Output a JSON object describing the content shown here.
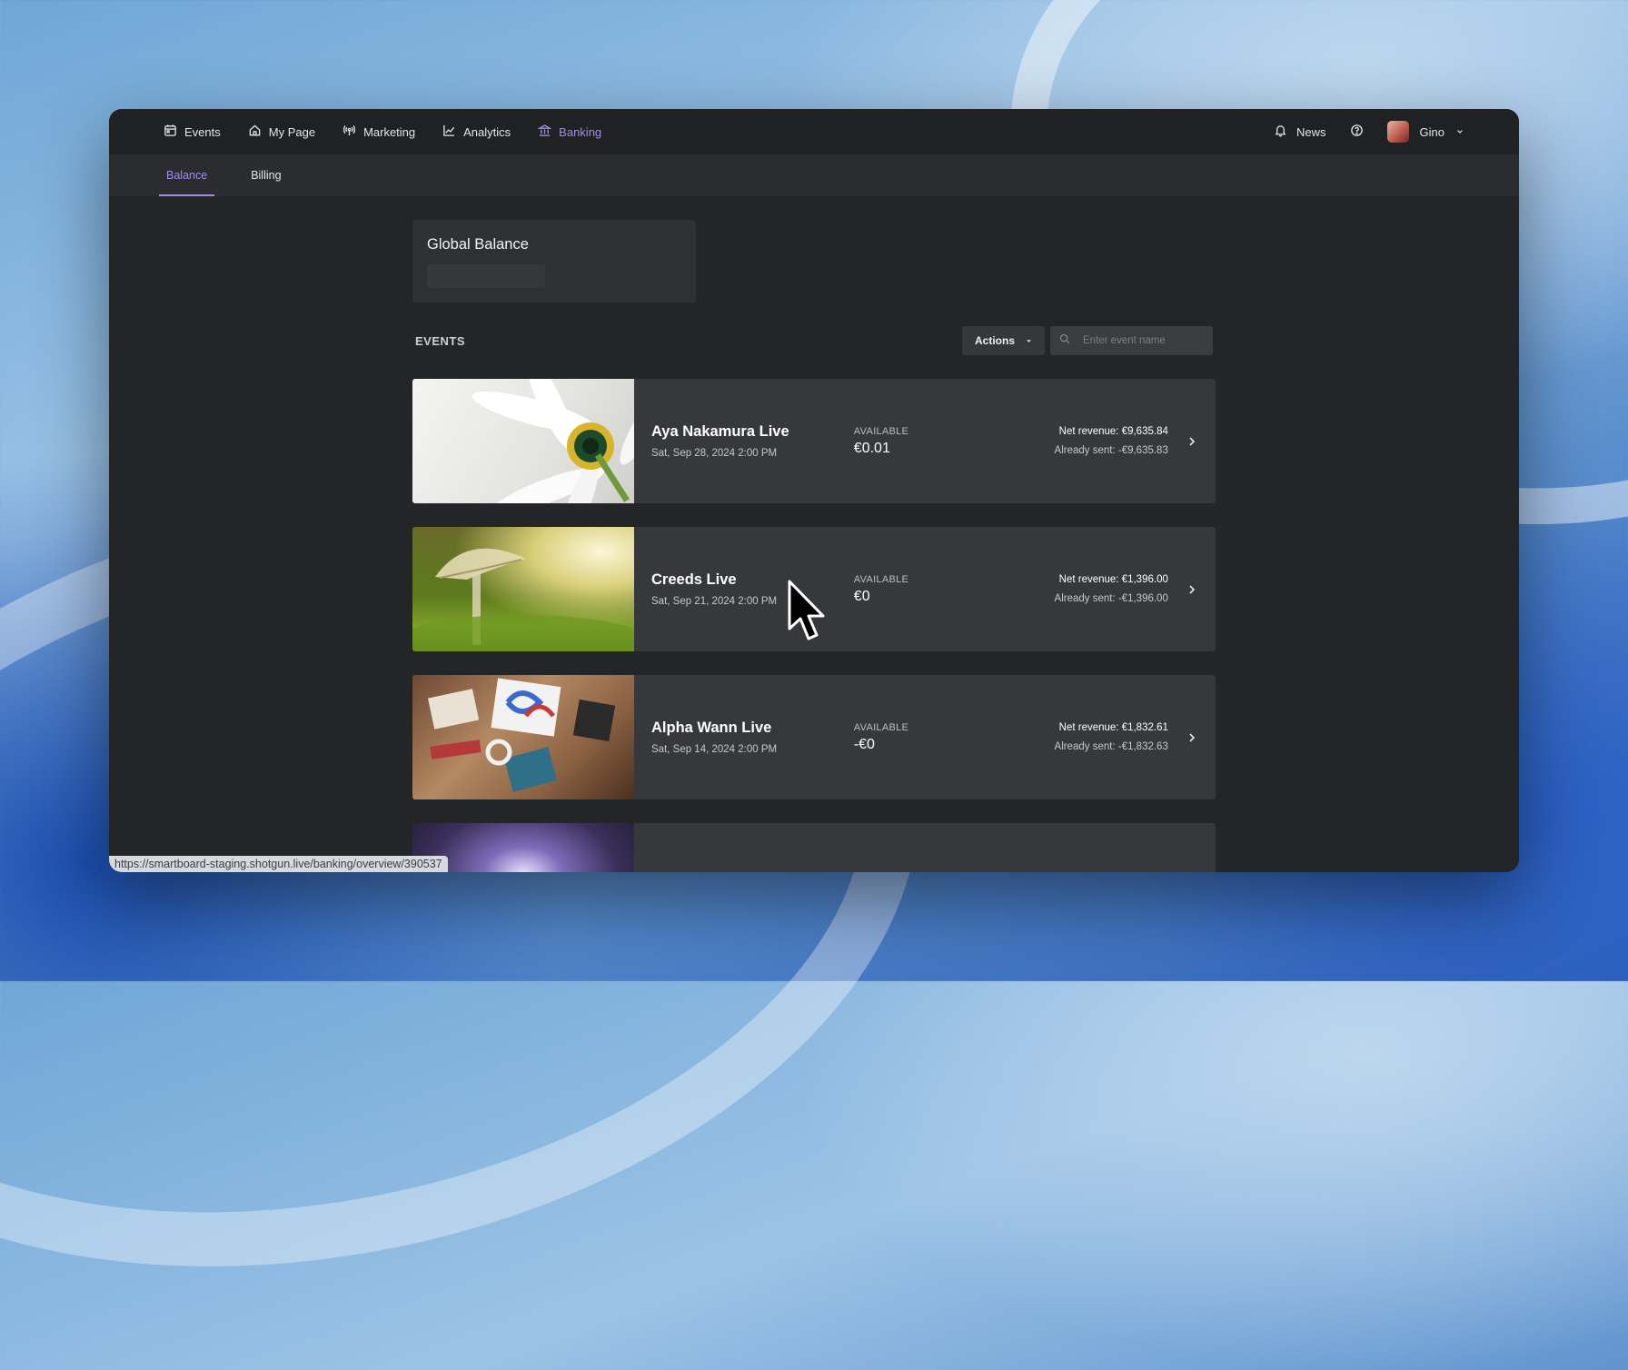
{
  "nav": {
    "items": [
      {
        "label": "Events",
        "icon": "calendar-icon"
      },
      {
        "label": "My Page",
        "icon": "home-icon"
      },
      {
        "label": "Marketing",
        "icon": "broadcast-icon"
      },
      {
        "label": "Analytics",
        "icon": "chart-line-icon"
      },
      {
        "label": "Banking",
        "icon": "bank-icon",
        "active": true
      }
    ],
    "news_label": "News",
    "user_name": "Gino"
  },
  "subnav": {
    "tabs": [
      {
        "label": "Balance",
        "active": true
      },
      {
        "label": "Billing"
      }
    ]
  },
  "balance": {
    "title": "Global Balance"
  },
  "events": {
    "section_label": "EVENTS",
    "actions_label": "Actions",
    "search_placeholder": "Enter event name",
    "available_label": "AVAILABLE",
    "rows": [
      {
        "name": "Aya Nakamura Live",
        "date": "Sat, Sep 28, 2024 2:00 PM",
        "available": "€0.01",
        "net_revenue": "Net revenue: €9,635.84",
        "already_sent": "Already sent: -€9,635.83"
      },
      {
        "name": "Creeds Live",
        "date": "Sat, Sep 21, 2024 2:00 PM",
        "available": "€0",
        "net_revenue": "Net revenue: €1,396.00",
        "already_sent": "Already sent: -€1,396.00"
      },
      {
        "name": "Alpha Wann Live",
        "date": "Sat, Sep 14, 2024 2:00 PM",
        "available": "-€0",
        "net_revenue": "Net revenue: €1,832.61",
        "already_sent": "Already sent: -€1,832.63"
      }
    ]
  },
  "status_url": "https://smartboard-staging.shotgun.live/banking/overview/390537",
  "colors": {
    "accent": "#a58bf0",
    "window_bg": "#232527",
    "card_bg": "#36383b"
  }
}
